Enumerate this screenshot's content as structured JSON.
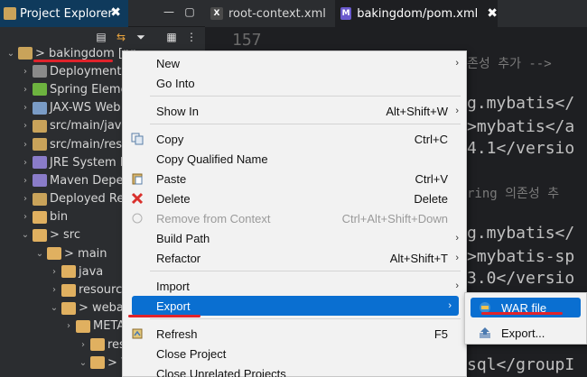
{
  "explorer": {
    "tab_title": "Project Explorer",
    "tab_close": "✖",
    "minimize": "—",
    "maximize": "▢",
    "tools": [
      "collapse-all-icon",
      "link-with-editor-icon",
      "filter-icon",
      "view-menu-icon",
      "more-icon"
    ],
    "tree": [
      {
        "arrow": "⌄",
        "label": "> bakingdom [pr",
        "color": "#c9a35a"
      },
      {
        "arrow": "›",
        "label": "Deployment D",
        "color": "#8a8a8a"
      },
      {
        "arrow": "›",
        "label": "Spring Eleme",
        "color": "#6db33f"
      },
      {
        "arrow": "›",
        "label": "JAX-WS Web",
        "color": "#7a9cc6"
      },
      {
        "arrow": "›",
        "label": "src/main/java",
        "color": "#c9a35a"
      },
      {
        "arrow": "›",
        "label": "src/main/reso",
        "color": "#c9a35a"
      },
      {
        "arrow": "›",
        "label": "JRE System Li",
        "color": "#8a7cc9"
      },
      {
        "arrow": "›",
        "label": "Maven Deper",
        "color": "#8a7cc9"
      },
      {
        "arrow": "›",
        "label": "Deployed Res",
        "color": "#c9a35a"
      },
      {
        "arrow": "›",
        "label": "bin",
        "color": "#e0b060"
      },
      {
        "arrow": "⌄",
        "label": "> src",
        "color": "#e0b060"
      },
      {
        "arrow": "⌄",
        "label": "> main",
        "color": "#e0b060"
      },
      {
        "arrow": "›",
        "label": "java",
        "color": "#e0b060"
      },
      {
        "arrow": "›",
        "label": "resource",
        "color": "#e0b060"
      },
      {
        "arrow": "⌄",
        "label": "> webap",
        "color": "#e0b060"
      },
      {
        "arrow": "›",
        "label": "META",
        "color": "#e0b060"
      },
      {
        "arrow": "›",
        "label": "resou",
        "color": "#e0b060"
      },
      {
        "arrow": "⌄",
        "label": "> WE",
        "color": "#e0b060"
      }
    ]
  },
  "editor": {
    "tabs": [
      {
        "label": "root-context.xml",
        "icon": "X",
        "icon_color": "#4a4a4a",
        "active": false
      },
      {
        "label": "bakingdom/pom.xml",
        "icon": "M",
        "icon_color": "#6a5acd",
        "active": true
      }
    ],
    "close_glyph": "✖",
    "lines": [
      {
        "text": "157"
      },
      {
        "text": "존성 추가 -->"
      },
      {
        "text": "g.mybatis</"
      },
      {
        "text": ">mybatis</a"
      },
      {
        "text": "4.1</versio"
      },
      {
        "text": "ring 의존성 추"
      },
      {
        "text": "g.mybatis</"
      },
      {
        "text": ">mybatis-sp"
      },
      {
        "text": "3.0</versio"
      },
      {
        "text": "sql</groupI"
      }
    ]
  },
  "context_menu": {
    "items": [
      {
        "label": "New",
        "shortcut": "",
        "submenu": true,
        "disabled": false,
        "icon": ""
      },
      {
        "label": "Go Into",
        "shortcut": "",
        "submenu": false,
        "disabled": false,
        "icon": ""
      },
      {
        "label": "Show In",
        "shortcut": "Alt+Shift+W",
        "submenu": true,
        "disabled": false,
        "icon": ""
      },
      {
        "label": "Copy",
        "shortcut": "Ctrl+C",
        "submenu": false,
        "disabled": false,
        "icon": "copy-icon"
      },
      {
        "label": "Copy Qualified Name",
        "shortcut": "",
        "submenu": false,
        "disabled": false,
        "icon": ""
      },
      {
        "label": "Paste",
        "shortcut": "Ctrl+V",
        "submenu": false,
        "disabled": false,
        "icon": "paste-icon"
      },
      {
        "label": "Delete",
        "shortcut": "Delete",
        "submenu": false,
        "disabled": false,
        "icon": "delete-icon"
      },
      {
        "label": "Remove from Context",
        "shortcut": "Ctrl+Alt+Shift+Down",
        "submenu": false,
        "disabled": true,
        "icon": "remove-context-icon"
      },
      {
        "label": "Build Path",
        "shortcut": "",
        "submenu": true,
        "disabled": false,
        "icon": ""
      },
      {
        "label": "Refactor",
        "shortcut": "Alt+Shift+T",
        "submenu": true,
        "disabled": false,
        "icon": ""
      },
      {
        "label": "Import",
        "shortcut": "",
        "submenu": true,
        "disabled": false,
        "icon": ""
      },
      {
        "label": "Export",
        "shortcut": "",
        "submenu": true,
        "disabled": false,
        "icon": ""
      },
      {
        "label": "Refresh",
        "shortcut": "F5",
        "submenu": false,
        "disabled": false,
        "icon": "refresh-icon"
      },
      {
        "label": "Close Project",
        "shortcut": "",
        "submenu": false,
        "disabled": false,
        "icon": ""
      },
      {
        "label": "Close Unrelated Projects",
        "shortcut": "",
        "submenu": false,
        "disabled": false,
        "icon": ""
      }
    ],
    "submenu_arrow": "›"
  },
  "export_submenu": {
    "items": [
      {
        "label": "WAR file",
        "icon": "war-file-icon"
      },
      {
        "label": "Export...",
        "icon": "export-icon"
      }
    ]
  },
  "colors": {
    "highlight": "#0a6fd1",
    "annotation_red": "#e0232b"
  }
}
